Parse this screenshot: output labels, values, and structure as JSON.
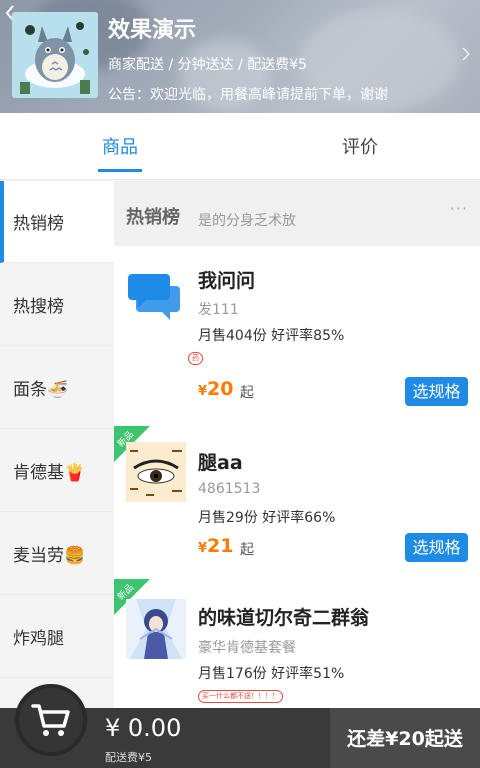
{
  "header": {
    "back_icon": "chevron-left-icon",
    "shop_name": "效果演示",
    "meta": "商家配送 / 分钟送达 / 配送费¥5",
    "notice": "公告：欢迎光临，用餐高峰请提前下单，谢谢",
    "chevron_icon": "chevron-right-icon"
  },
  "tabs": [
    {
      "label": "商品",
      "active": true
    },
    {
      "label": "评价",
      "active": false
    }
  ],
  "sidebar": {
    "items": [
      {
        "label": "热销榜",
        "active": true
      },
      {
        "label": "热搜榜",
        "active": false
      },
      {
        "label": "面条🍜",
        "active": false
      },
      {
        "label": "肯德基🍟",
        "active": false
      },
      {
        "label": "麦当劳🍔",
        "active": false
      },
      {
        "label": "炸鸡腿",
        "active": false
      }
    ]
  },
  "category": {
    "title": "热销榜",
    "subtitle": "是的分身乏术放",
    "more_icon": "ellipsis-icon"
  },
  "items": [
    {
      "name": "我问问",
      "desc": "发111",
      "stats": "月售404份  好评率85%",
      "tag": "药",
      "price_symbol": "¥",
      "price": "20",
      "price_suffix": "起",
      "button": "选规格",
      "new": false,
      "image_icon": "chat-bubbles-icon"
    },
    {
      "name": "腿aa",
      "desc": "4861513",
      "stats": "月售29份  好评率66%",
      "price_symbol": "¥",
      "price": "21",
      "price_suffix": "起",
      "button": "选规格",
      "new": true,
      "new_label": "新品",
      "image_icon": "eye-diagram-image"
    },
    {
      "name": "的味道切尔奇二群翁",
      "desc": "豪华肯德基套餐",
      "stats": "月售176份  好评率51%",
      "tag": "买一什么都不送！！！！",
      "new": true,
      "new_label": "新品",
      "image_icon": "anime-character-image"
    }
  ],
  "cart": {
    "icon": "shopping-cart-icon",
    "total": "¥ 0.00",
    "delivery_fee": "配送费¥5",
    "checkout_label": "还差¥20起送"
  },
  "colors": {
    "accent": "#1e8be6",
    "price": "#ff7a00",
    "new_badge": "#3cc46f",
    "bottom_bar": "#3a3a3a"
  }
}
